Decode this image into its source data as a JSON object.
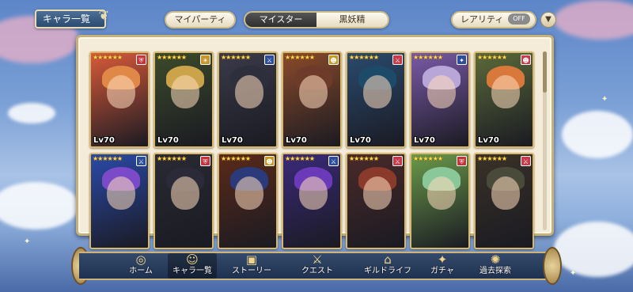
{
  "header": {
    "title": "キャラ一覧",
    "my_party_label": "マイパーティ",
    "tabs": [
      {
        "label": "マイスター",
        "active": true
      },
      {
        "label": "黒妖精",
        "active": false
      }
    ],
    "rarity_label": "レアリティ",
    "toggle_label": "OFF"
  },
  "cards": [
    {
      "level": "Lv70",
      "stars": "★★★★★★",
      "element": "shield",
      "element_color": "#c8323a",
      "hair": "#e08848",
      "bg": "#d85a3a"
    },
    {
      "level": "Lv70",
      "stars": "★★★★★★",
      "element": "sun",
      "element_color": "#c6962c",
      "hair": "#caa34a",
      "bg": "#3c4a2a"
    },
    {
      "level": "Lv70",
      "stars": "★★★★★★",
      "element": "sword",
      "element_color": "#2c4c9c",
      "hair": "#2e2f3c",
      "bg": "#3a3a4a"
    },
    {
      "level": "Lv70",
      "stars": "★★★★★★",
      "element": "face",
      "element_color": "#c49a22",
      "hair": "#6e3a2a",
      "bg": "#8a4a2a"
    },
    {
      "level": "Lv70",
      "stars": "★★★★★★",
      "element": "sword",
      "element_color": "#c83a4a",
      "hair": "#1e4a6a",
      "bg": "#2a4a6e"
    },
    {
      "level": "Lv70",
      "stars": "★★★★★★",
      "element": "spark",
      "element_color": "#2c4c9c",
      "hair": "#b8a6d8",
      "bg": "#7a5aa8"
    },
    {
      "level": "Lv70",
      "stars": "★★★★★★",
      "element": "face",
      "element_color": "#c83a4a",
      "hair": "#d8783a",
      "bg": "#5a6a3a"
    },
    {
      "level": "",
      "stars": "★★★★★★",
      "element": "sword",
      "element_color": "#2c4c9c",
      "hair": "#7a4ac8",
      "bg": "#2a4aa8"
    },
    {
      "level": "",
      "stars": "★★★★★★",
      "element": "shield",
      "element_color": "#c8323a",
      "hair": "#2a2a38",
      "bg": "#2a2a34"
    },
    {
      "level": "",
      "stars": "★★★★★★",
      "element": "face",
      "element_color": "#c49a22",
      "hair": "#2a3a7a",
      "bg": "#5a2a1a"
    },
    {
      "level": "",
      "stars": "★★★★★★",
      "element": "sword",
      "element_color": "#2c4c9c",
      "hair": "#6a3ab8",
      "bg": "#3a2a7a"
    },
    {
      "level": "",
      "stars": "★★★★★★",
      "element": "sword",
      "element_color": "#c83a4a",
      "hair": "#8a3a2a",
      "bg": "#4a2a2a"
    },
    {
      "level": "",
      "stars": "★★★★★★",
      "element": "shield",
      "element_color": "#c8323a",
      "hair": "#8ac89a",
      "bg": "#6a9a4a"
    },
    {
      "level": "",
      "stars": "★★★★★★",
      "element": "sword",
      "element_color": "#c83a4a",
      "hair": "#4a4a3a",
      "bg": "#3a3228"
    }
  ],
  "nav": {
    "items": [
      {
        "label": "ホーム",
        "icon": "compass-icon",
        "glyph": "◎",
        "active": false
      },
      {
        "label": "キャラ一覧",
        "icon": "characters-icon",
        "glyph": "☺",
        "active": true
      },
      {
        "label": "ストーリー",
        "icon": "book-icon",
        "glyph": "▣",
        "active": false
      },
      {
        "label": "クエスト",
        "icon": "quest-icon",
        "glyph": "⚔",
        "active": false
      },
      {
        "label": "ギルドライフ",
        "icon": "guild-icon",
        "glyph": "⌂",
        "active": false
      },
      {
        "label": "ガチャ",
        "icon": "gacha-icon",
        "glyph": "✦",
        "active": false
      },
      {
        "label": "過去探索",
        "icon": "explore-icon",
        "glyph": "✺",
        "active": false
      }
    ]
  },
  "colors": {
    "panel_bg": "#f4ecd8",
    "gold_border": "#c6b07c",
    "nav_bg": "#263a5c"
  }
}
